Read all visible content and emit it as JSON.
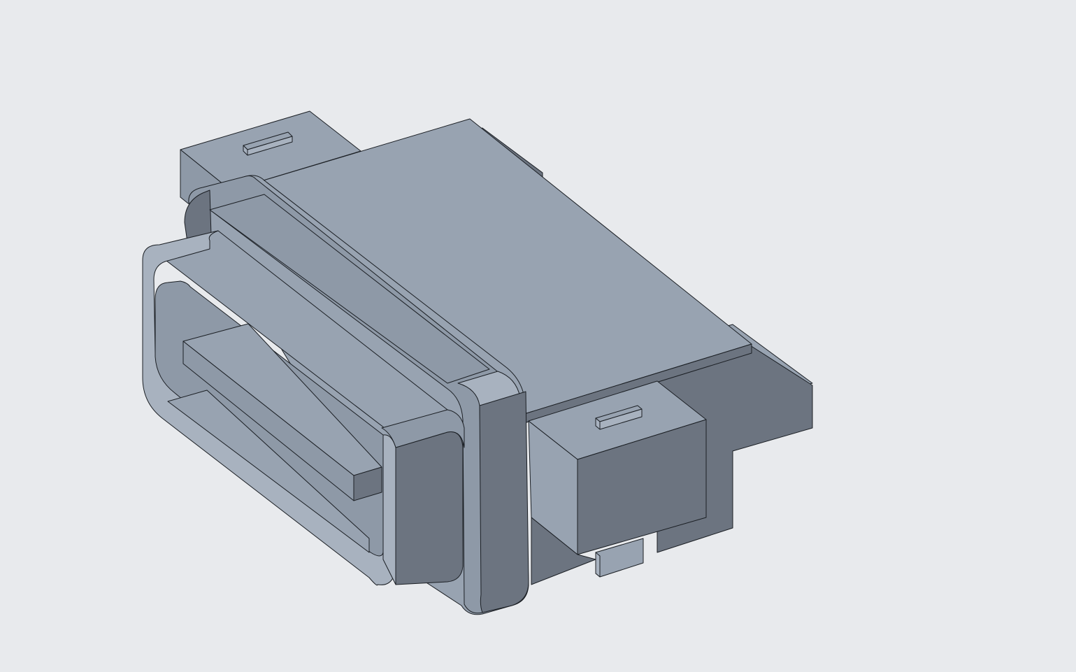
{
  "viewport": {
    "background": "#e8eaed",
    "model": "connector-3d-model"
  },
  "colors": {
    "face_top": "#98a3b1",
    "face_top_mid": "#8e99a7",
    "face_side": "#6c7480",
    "face_front": "#a8b2bf",
    "edge": "#1b1f24"
  }
}
